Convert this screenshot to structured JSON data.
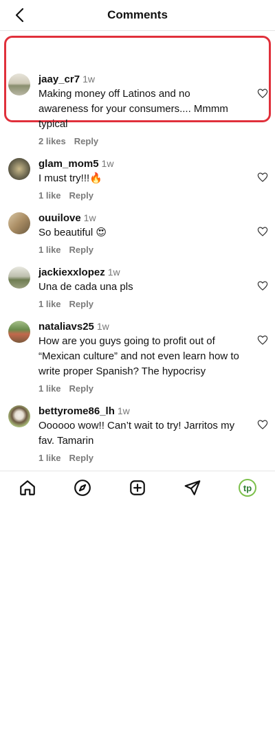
{
  "header": {
    "title": "Comments"
  },
  "comments": [
    {
      "user": "jaay_cr7",
      "time": "1w",
      "text": "Making money off Latinos and no awareness for your consumers.... Mmmm typical",
      "likes": "2 likes",
      "reply": "Reply"
    },
    {
      "user": "glam_mom5",
      "time": "1w",
      "text": "I must try!!!🔥",
      "likes": "1 like",
      "reply": "Reply"
    },
    {
      "user": "ouuilove",
      "time": "1w",
      "text": "So beautiful 😍",
      "likes": "1 like",
      "reply": "Reply"
    },
    {
      "user": "jackiexxlopez",
      "time": "1w",
      "text": "Una de cada una pls",
      "likes": "1 like",
      "reply": "Reply"
    },
    {
      "user": "nataliavs25",
      "time": "1w",
      "text": "How are you guys going to profit out of “Mexican culture” and not even learn how to write proper Spanish? The hypocrisy",
      "likes": "1 like",
      "reply": "Reply"
    },
    {
      "user": "bettyrome86_lh",
      "time": "1w",
      "text": "Oooooo wow!! Can’t wait to try! Jarritos my fav. Tamarin",
      "likes": "1 like",
      "reply": "Reply"
    }
  ],
  "nav": {
    "profile_initials": "tp"
  },
  "colors": {
    "highlight": "#e0303b",
    "profile_ring": "#7cc04b"
  }
}
